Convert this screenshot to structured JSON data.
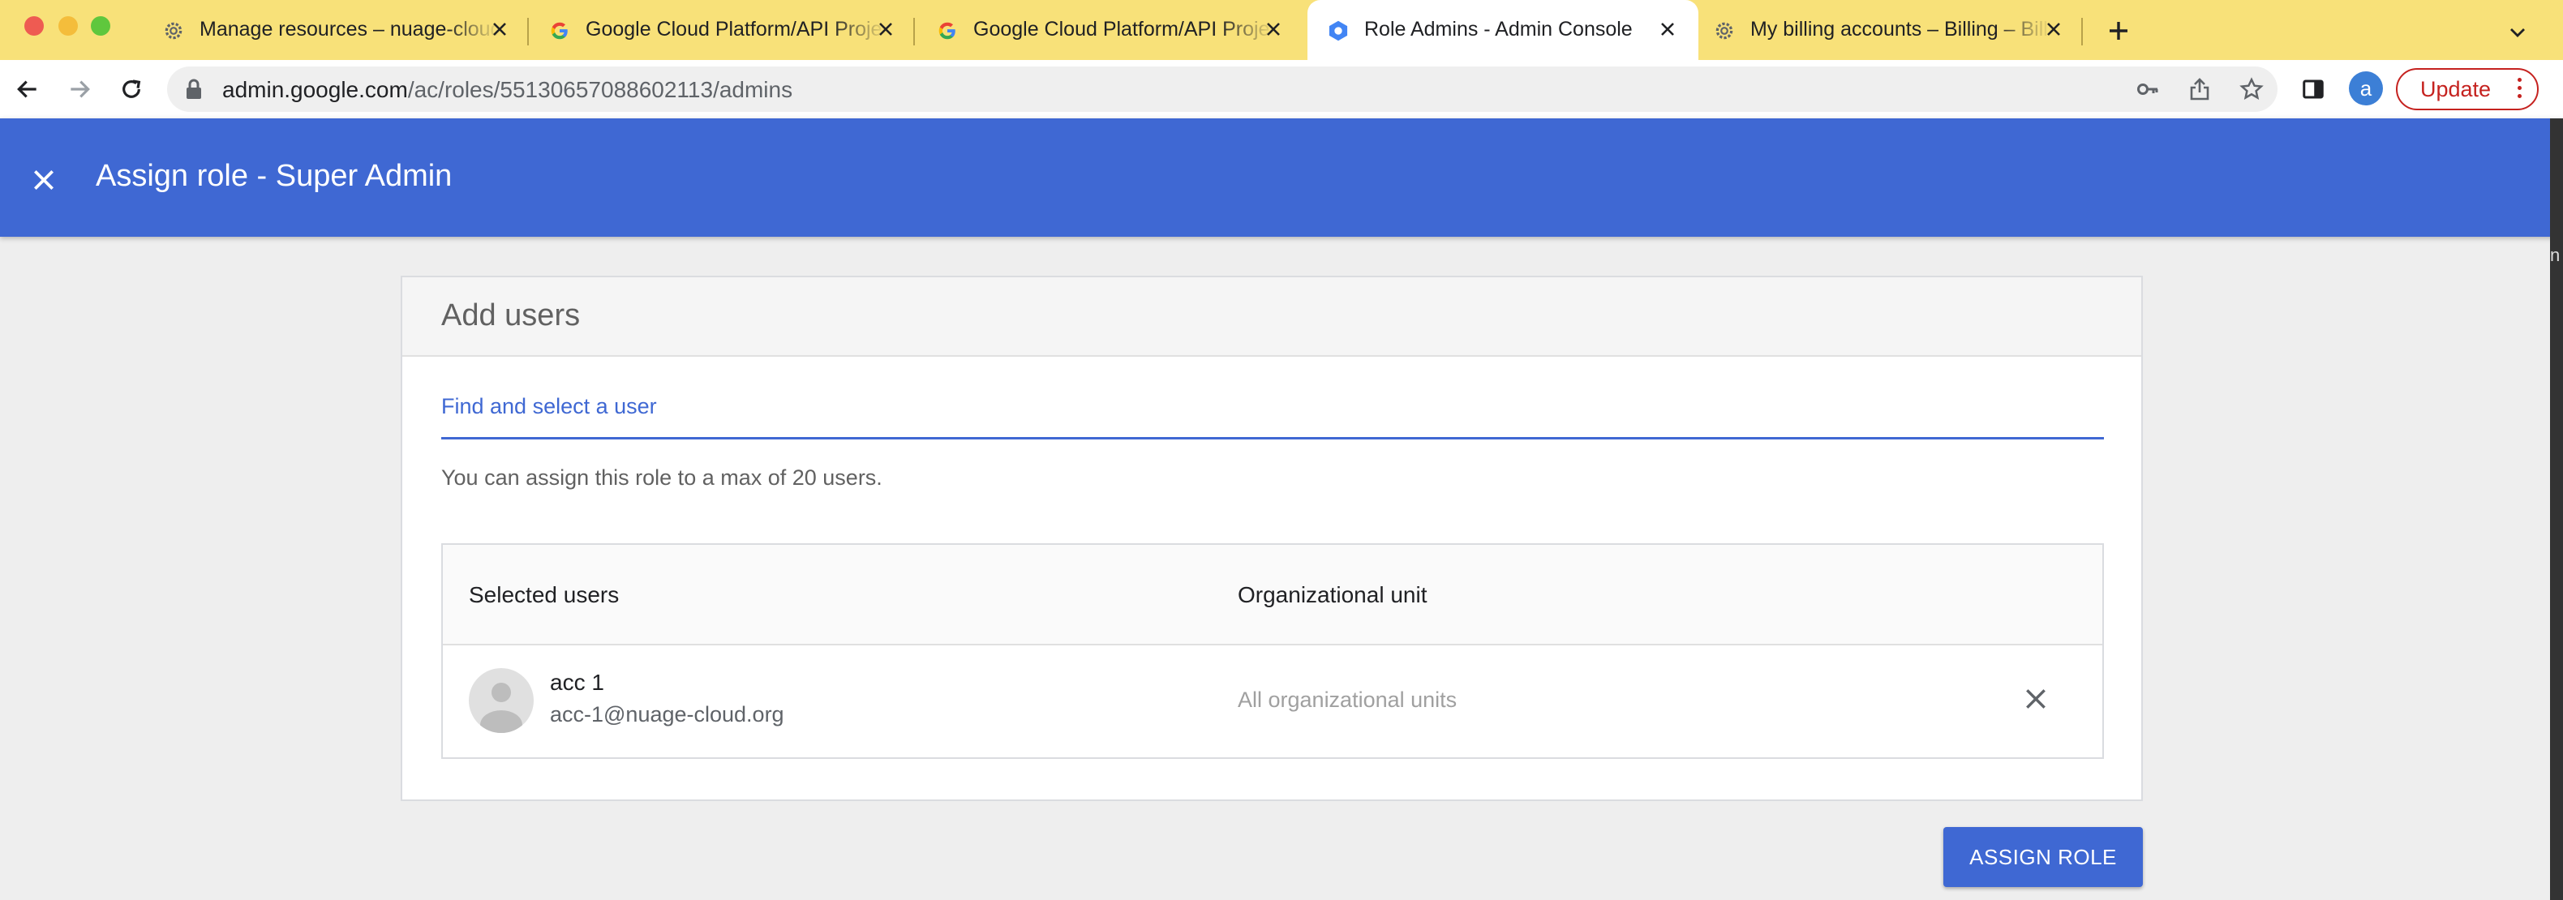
{
  "browser": {
    "tabs": [
      {
        "title": "Manage resources – nuage-cloud",
        "favicon": "gear-icon",
        "active": false
      },
      {
        "title": "Google Cloud Platform/API Project",
        "favicon": "google-g-icon",
        "active": false
      },
      {
        "title": "Google Cloud Platform/API Project",
        "favicon": "google-g-icon",
        "active": false
      },
      {
        "title": "Role Admins - Admin Console",
        "favicon": "admin-console-icon",
        "active": true
      },
      {
        "title": "My billing accounts – Billing – Billing",
        "favicon": "gear-icon",
        "active": false
      }
    ],
    "url": {
      "host": "admin.google.com",
      "path": "/ac/roles/55130657088602113/admins"
    },
    "profile_initial": "a",
    "update_label": "Update"
  },
  "header": {
    "title": "Assign role - Super Admin"
  },
  "card": {
    "title": "Add users",
    "search_label": "Find and select a user",
    "hint": "You can assign this role to a max of 20 users."
  },
  "table": {
    "columns": [
      "Selected users",
      "Organizational unit"
    ],
    "rows": [
      {
        "name": "acc 1",
        "email": "acc-1@nuage-cloud.org",
        "org_unit": "All organizational units"
      }
    ]
  },
  "actions": {
    "assign_label": "ASSIGN ROLE"
  },
  "edge_text": "n",
  "colors": {
    "tabstrip": "#f8e179",
    "primary": "#3f68d3",
    "danger": "#c5221f"
  }
}
